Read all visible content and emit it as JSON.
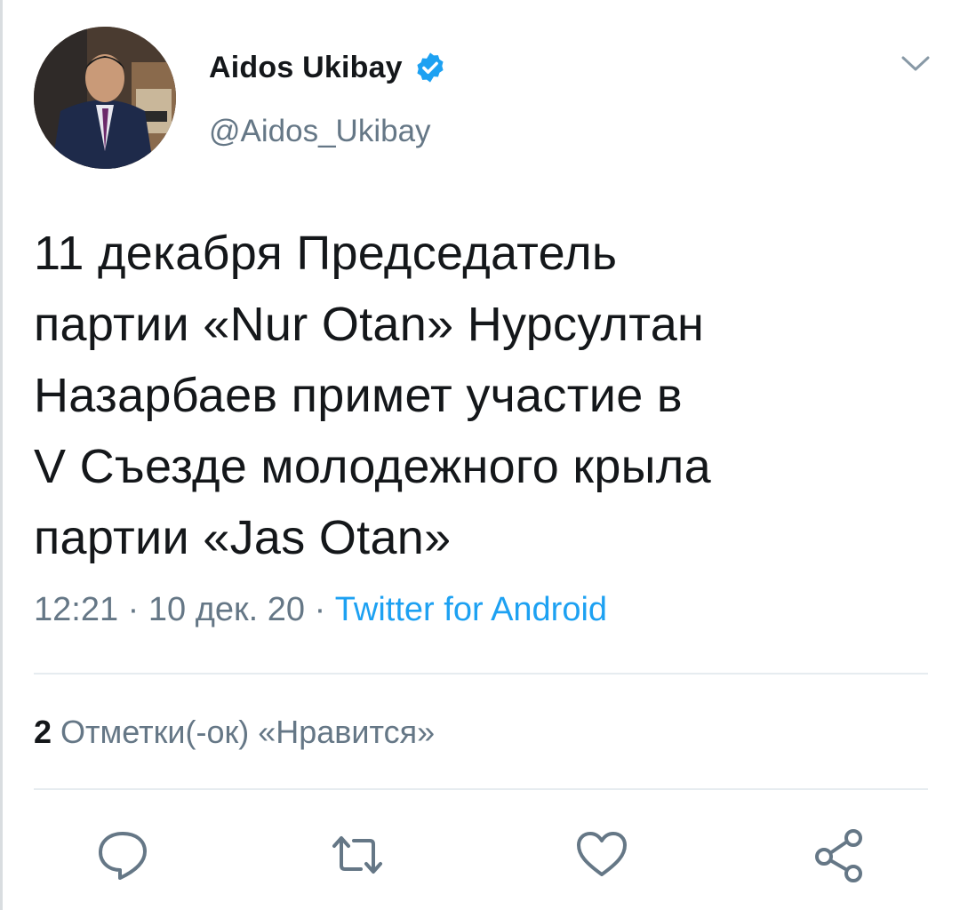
{
  "tweet": {
    "author": {
      "display_name": "Aidos Ukibay",
      "handle": "@Aidos_Ukibay",
      "verified": true,
      "verified_icon": "verified-badge-icon"
    },
    "text_lines": [
      "11 декабря Председатель",
      "партии «Nur Otan» Нурсултан",
      "Назарбаев примет участие в",
      "V Съезде молодежного крыла",
      "партии «Jas Otan»"
    ],
    "time": "12:21",
    "separator": " · ",
    "date": "10 дек. 20",
    "source": "Twitter for Android",
    "likes_count": "2",
    "likes_label": "Отметки(-ок) «Нравится»"
  },
  "actions": [
    {
      "name": "reply",
      "icon": "reply-icon"
    },
    {
      "name": "retweet",
      "icon": "retweet-icon"
    },
    {
      "name": "like",
      "icon": "heart-icon"
    },
    {
      "name": "share",
      "icon": "share-icon"
    }
  ],
  "colors": {
    "text": "#14171a",
    "secondary": "#657786",
    "accent": "#1da1f2",
    "divider": "#e6ecf0"
  }
}
